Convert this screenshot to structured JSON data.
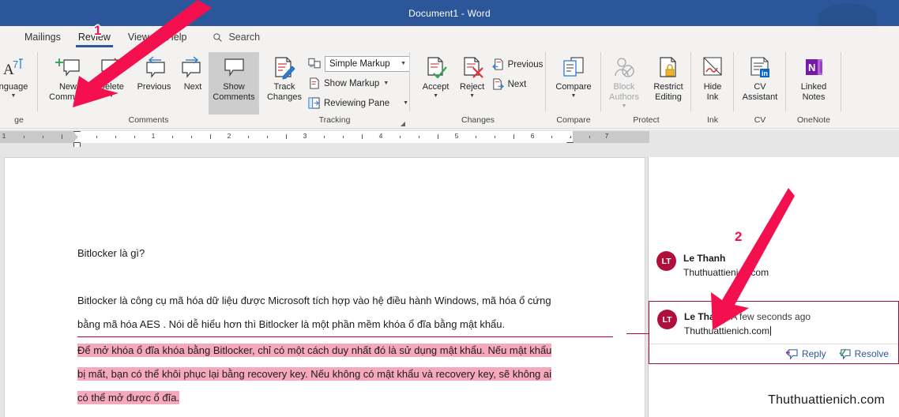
{
  "titlebar": {
    "title": "Document1  -  Word"
  },
  "tabs": [
    {
      "label": "Mailings",
      "active": false
    },
    {
      "label": "Review",
      "active": true
    },
    {
      "label": "View",
      "active": false
    },
    {
      "label": "Help",
      "active": false
    }
  ],
  "search": {
    "label": "Search",
    "icon": "search-icon"
  },
  "ribbon": {
    "groups": [
      {
        "name": "ge",
        "full_name": "Language",
        "buttons": [
          {
            "label": "nguage",
            "icon": "language-icon",
            "caret": true,
            "disabled": false
          }
        ]
      },
      {
        "name": "Comments",
        "buttons": [
          {
            "label": "New\nComment",
            "icon": "new-comment-icon",
            "caret": false,
            "disabled": false
          },
          {
            "label": "Delete",
            "icon": "delete-comment-icon",
            "caret": true,
            "disabled": false
          },
          {
            "label": "Previous",
            "icon": "previous-comment-icon",
            "caret": false,
            "disabled": false
          },
          {
            "label": "Next",
            "icon": "next-comment-icon",
            "caret": false,
            "disabled": false
          },
          {
            "label": "Show\nComments",
            "icon": "show-comments-icon",
            "caret": false,
            "pressed": true
          }
        ]
      },
      {
        "name": "Tracking",
        "has_dialog_launcher": true,
        "buttons": [
          {
            "label": "Track\nChanges",
            "icon": "track-changes-icon",
            "caret": true
          }
        ],
        "small_rows": [
          {
            "label": "Simple Markup",
            "icon": "markup-view-icon",
            "type": "combo",
            "caret": true
          },
          {
            "label": "Show Markup",
            "icon": "show-markup-icon",
            "type": "menu",
            "caret": true
          },
          {
            "label": "Reviewing Pane",
            "icon": "reviewing-pane-icon",
            "type": "menu",
            "caret": true
          }
        ]
      },
      {
        "name": "Changes",
        "buttons": [
          {
            "label": "Accept",
            "icon": "accept-change-icon",
            "caret": true
          },
          {
            "label": "Reject",
            "icon": "reject-change-icon",
            "caret": true
          }
        ],
        "small_rows": [
          {
            "label": "Previous",
            "icon": "previous-change-icon",
            "type": "plain"
          },
          {
            "label": "Next",
            "icon": "next-change-icon",
            "type": "plain"
          }
        ]
      },
      {
        "name": "Compare",
        "buttons": [
          {
            "label": "Compare",
            "icon": "compare-icon",
            "caret": true
          }
        ]
      },
      {
        "name": "Protect",
        "buttons": [
          {
            "label": "Block\nAuthors",
            "icon": "block-authors-icon",
            "caret": true,
            "disabled": true
          },
          {
            "label": "Restrict\nEditing",
            "icon": "restrict-editing-icon",
            "caret": false
          }
        ]
      },
      {
        "name": "Ink",
        "buttons": [
          {
            "label": "Hide\nInk",
            "icon": "hide-ink-icon",
            "caret": false
          }
        ]
      },
      {
        "name": "CV",
        "buttons": [
          {
            "label": "CV\nAssistant",
            "icon": "cv-assistant-icon",
            "caret": false
          }
        ]
      },
      {
        "name": "OneNote",
        "buttons": [
          {
            "label": "Linked\nNotes",
            "icon": "onenote-icon",
            "caret": false
          }
        ]
      }
    ]
  },
  "ruler": {
    "start_label": "1",
    "numbers": [
      "1",
      "2",
      "3",
      "4",
      "5",
      "6",
      "7"
    ]
  },
  "document": {
    "paragraphs": [
      {
        "text": "Bitlocker là gì?",
        "highlight": false
      },
      {
        "text": "",
        "highlight": false
      },
      {
        "text": "Bitlocker là công cụ mã hóa dữ liệu được Microsoft tích hợp vào hệ điều hành Windows, mã hóa ổ cứng",
        "highlight": false
      },
      {
        "text": "bằng mã hóa AES . Nói dễ hiểu hơn thì Bitlocker là một phần mềm khóa ổ đĩa bằng mật khẩu.",
        "highlight": false
      }
    ],
    "highlighted": [
      "Để mở khóa ổ đĩa khóa bằng Bitlocker, chỉ có một cách duy nhất đó là sử dụng mật khẩu. Nếu mật khẩu",
      "bị mất, bạn có thể khôi phục lại bằng recovery key. Nếu không có mật khẩu và recovery key, sẽ không ai",
      "có thể mở được ổ đĩa."
    ],
    "highlight_color": "#f6a8bc"
  },
  "comments_pane": {
    "comments": [
      {
        "initials": "LT",
        "author": "Le Thanh",
        "time": "",
        "text": "Thuthuattienich.com",
        "selected": false
      },
      {
        "initials": "LT",
        "author": "Le Thanh",
        "time": "A few seconds ago",
        "text": "Thuthuattienich.com",
        "selected": true,
        "actions": [
          {
            "label": "Reply",
            "icon": "reply-icon"
          },
          {
            "label": "Resolve",
            "icon": "resolve-icon"
          }
        ]
      }
    ],
    "avatar_color": "#b00f3c",
    "selected_border_color": "#a3123f"
  },
  "annotations": {
    "color": "#f4104e",
    "markers": [
      {
        "label": "1"
      },
      {
        "label": "2"
      }
    ]
  },
  "watermark": {
    "text": "Thuthuattienich.com"
  }
}
